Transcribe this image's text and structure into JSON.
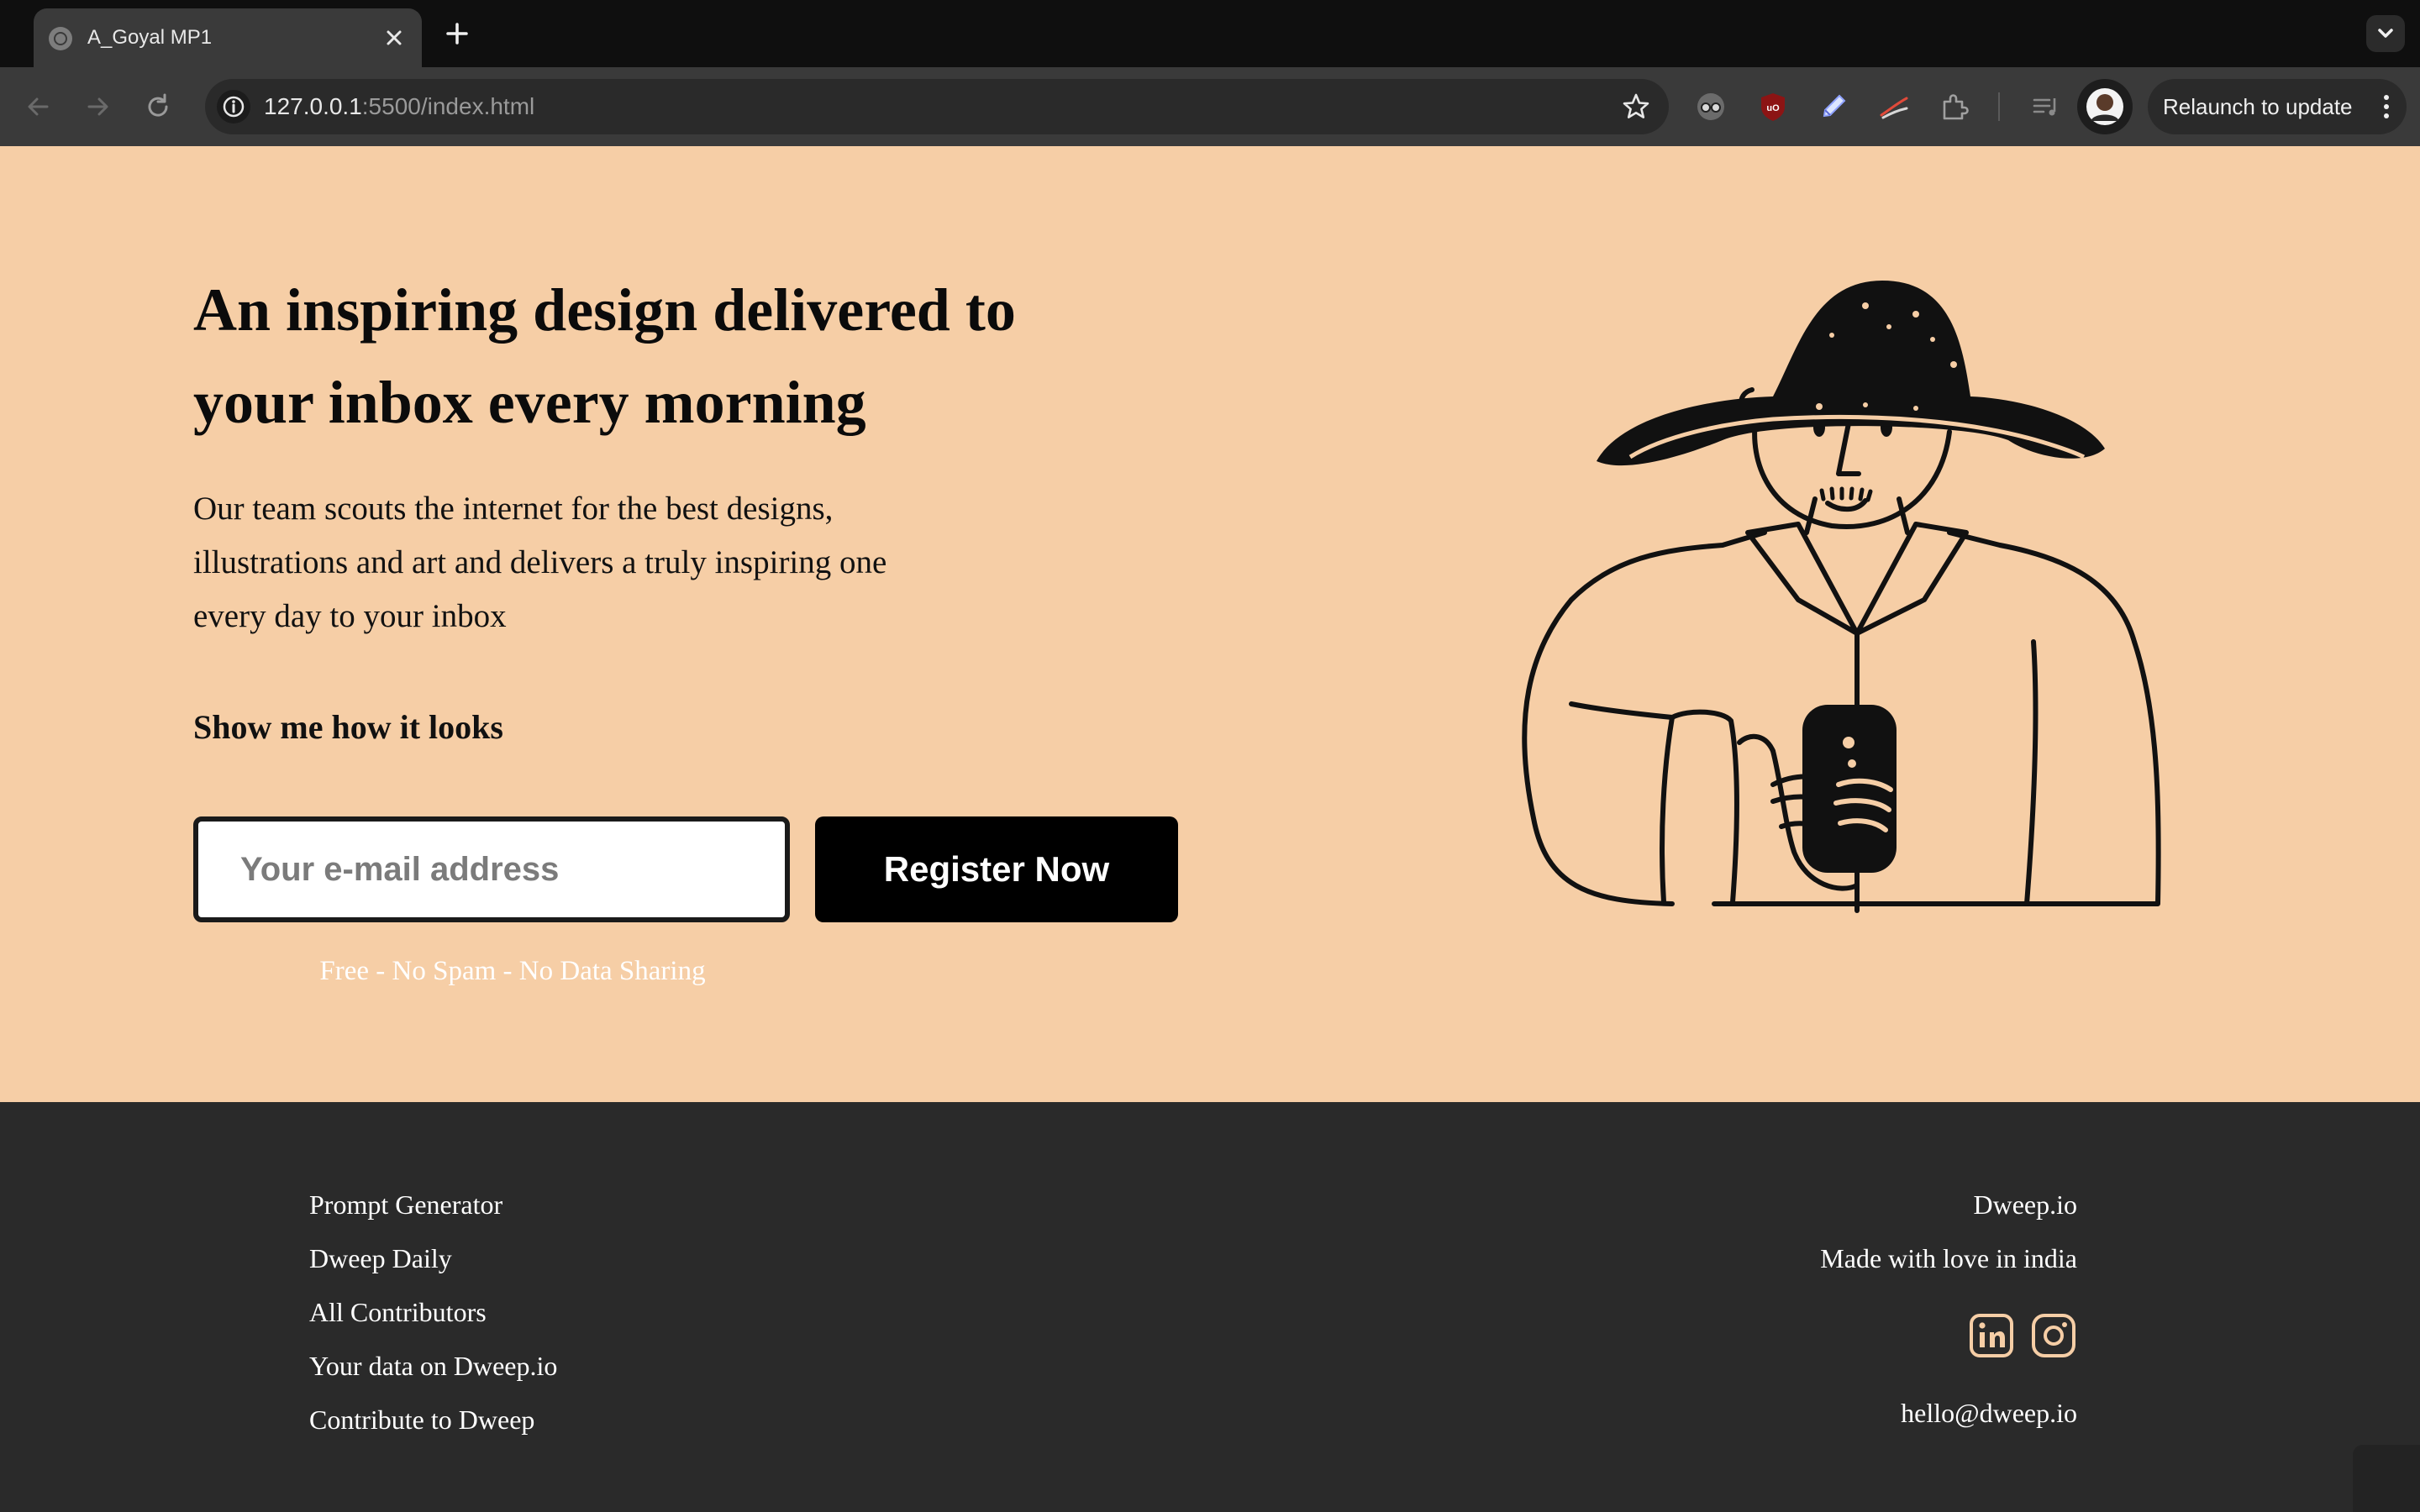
{
  "browser": {
    "tab_title": "A_Goyal MP1",
    "url_host": "127.0.0.1",
    "url_rest": ":5500/index.html",
    "relaunch_label": "Relaunch to update"
  },
  "hero": {
    "title": "An inspiring design delivered to your inbox every morning",
    "description": "Our team scouts the internet for the best designs, illustrations and art and delivers a truly inspiring one every day to your inbox",
    "cta_link": "Show me how it looks",
    "email_placeholder": "Your e-mail address",
    "register_label": "Register Now",
    "disclaimer": "Free - No Spam - No Data Sharing",
    "background_color": "#f6cea6"
  },
  "footer": {
    "links": [
      "Prompt Generator",
      "Dweep Daily",
      "All Contributors",
      "Your data on Dweep.io",
      "Contribute to Dweep"
    ],
    "brand": "Dweep.io",
    "tagline": "Made with love in india",
    "email": "hello@dweep.io",
    "social_icons": [
      "linkedin-icon",
      "instagram-icon"
    ],
    "background_color": "#2a2a2a"
  }
}
